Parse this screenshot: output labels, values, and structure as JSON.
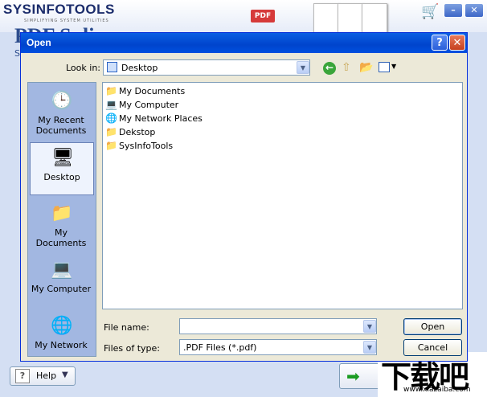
{
  "app": {
    "logo_text": "SYSINFOTOOLS",
    "logo_tagline": "SIMPLIFYING SYSTEM UTILITIES",
    "title_behind": "PDF Spli",
    "subtitle_behind": "S",
    "pdf_tag": "PDF",
    "help_button": "Help",
    "next_button_partial": "N"
  },
  "dialog": {
    "title": "Open",
    "help_glyph": "?",
    "close_glyph": "✕",
    "look_in_label": "Look in:",
    "look_in_value": "Desktop",
    "places": [
      {
        "label": "My Recent Documents"
      },
      {
        "label": "Desktop"
      },
      {
        "label": "My Documents"
      },
      {
        "label": "My Computer"
      },
      {
        "label": "My Network"
      }
    ],
    "files": [
      {
        "label": "My Documents",
        "icon": "my-documents-icon"
      },
      {
        "label": "My Computer",
        "icon": "computer-icon"
      },
      {
        "label": "My Network Places",
        "icon": "network-icon"
      },
      {
        "label": "Dekstop",
        "icon": "folder-icon"
      },
      {
        "label": "SysInfoTools",
        "icon": "folder-icon"
      }
    ],
    "file_name_label": "File name:",
    "file_name_value": "",
    "files_of_type_label": "Files of type:",
    "files_of_type_value": ".PDF Files (*.pdf)",
    "open_button": "Open",
    "cancel_button": "Cancel"
  },
  "watermark": {
    "big_text": "下载吧",
    "url": "www.xiazaiba.com"
  },
  "colors": {
    "titlebar": "#0044cc",
    "places_bar": "#a2b7e1",
    "dialog_bg": "#ece9d8",
    "folder": "#e8b935"
  }
}
